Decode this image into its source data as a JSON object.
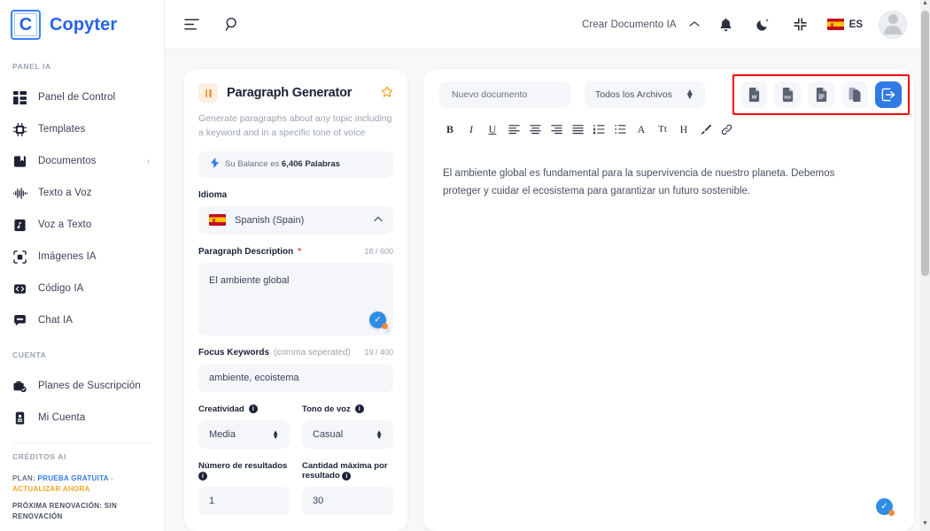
{
  "brand": {
    "mark": "C",
    "name": "Copyter"
  },
  "sidebar": {
    "section_panel": "PANEL IA",
    "items": [
      {
        "label": "Panel de Control",
        "icon": "dashboard-icon"
      },
      {
        "label": "Templates",
        "icon": "chip-icon"
      },
      {
        "label": "Documentos",
        "icon": "documents-icon",
        "caret": "›"
      },
      {
        "label": "Texto a Voz",
        "icon": "waveform-icon"
      },
      {
        "label": "Voz a Texto",
        "icon": "audio-file-icon"
      },
      {
        "label": "Imágenes IA",
        "icon": "image-ai-icon"
      },
      {
        "label": "Código IA",
        "icon": "code-icon"
      },
      {
        "label": "Chat IA",
        "icon": "chat-icon"
      }
    ],
    "section_account": "CUENTA",
    "account_items": [
      {
        "label": "Planes de Suscripción",
        "icon": "subscription-icon"
      },
      {
        "label": "Mi Cuenta",
        "icon": "account-card-icon"
      }
    ],
    "section_credits": "CRÉDITOS AI",
    "plan_prefix": "PLAN:",
    "plan_value": "PRUEBA GRATUITA",
    "plan_sep": "-",
    "plan_upgrade": "ACTUALIZAR AHORA",
    "renewal": "PRÓXIMA RENOVACIÓN: SIN RENOVACIÓN"
  },
  "topbar": {
    "menu_icon": "menu-lines-icon",
    "search_icon": "search-icon",
    "create_doc": "Crear Documento IA",
    "chevron": "⌃",
    "bell_icon": "bell-icon",
    "theme_icon": "moon-icon",
    "fullscreen_icon": "compress-icon",
    "lang_code": "ES",
    "lang_flag": "flag-es-icon",
    "avatar": "user-avatar"
  },
  "generator": {
    "badge_icon": "template-bars-icon",
    "title": "Paragraph Generator",
    "star_icon": "star-outline-icon",
    "description": "Generate paragraphs about any topic including a keyword and in a specific tone of voice",
    "balance_bolt": "⚡",
    "balance_prefix": "Su Balance es ",
    "balance_value": "6,406 Palabras",
    "language_label": "Idioma",
    "language_value": "Spanish (Spain)",
    "desc_label": "Paragraph Description",
    "desc_required": "*",
    "desc_counter": "18 / 600",
    "desc_value": "El ambiente global",
    "keywords_label": "Focus Keywords",
    "keywords_hint": "(comma seperated)",
    "keywords_counter": "19 / 400",
    "keywords_value": "ambiente, ecoistema",
    "creativity_label": "Creatividad",
    "creativity_value": "Media",
    "tone_label": "Tono de voz",
    "tone_value": "Casual",
    "results_label": "Número de resultados",
    "results_value": "1",
    "maxlen_label": "Cantidad máxima por resultado",
    "maxlen_value": "30"
  },
  "editor": {
    "doc_name_value": "Nuevo documento",
    "file_filter_value": "Todos los Archivos",
    "export_buttons": [
      {
        "name": "export-word-button",
        "label": "W"
      },
      {
        "name": "export-pdf-button",
        "label": "PDF"
      },
      {
        "name": "export-text-button",
        "label": "TXT"
      },
      {
        "name": "copy-document-button",
        "label": "COPY"
      },
      {
        "name": "save-document-button",
        "label": "SAVE"
      }
    ],
    "format_buttons": [
      {
        "name": "bold-button",
        "glyph": "B"
      },
      {
        "name": "italic-button",
        "glyph": "I"
      },
      {
        "name": "underline-button",
        "glyph": "U"
      },
      {
        "name": "align-left-button",
        "glyph": "align-left-icon"
      },
      {
        "name": "align-center-button",
        "glyph": "align-center-icon"
      },
      {
        "name": "align-right-button",
        "glyph": "align-right-icon"
      },
      {
        "name": "align-justify-button",
        "glyph": "align-justify-icon"
      },
      {
        "name": "ordered-list-button",
        "glyph": "ordered-list-icon"
      },
      {
        "name": "unordered-list-button",
        "glyph": "unordered-list-icon"
      },
      {
        "name": "font-color-button",
        "glyph": "A"
      },
      {
        "name": "font-size-button",
        "glyph": "Tt"
      },
      {
        "name": "heading-button",
        "glyph": "H"
      },
      {
        "name": "highlight-button",
        "glyph": "brush-icon"
      },
      {
        "name": "link-button",
        "glyph": "link-icon"
      }
    ],
    "content": "El ambiente global es fundamental para la supervivencia de nuestro planeta. Debemos proteger y cuidar el ecosistema para garantizar un futuro sostenible."
  },
  "colors": {
    "brand_blue": "#2563eb",
    "accent_blue": "#2f7ae5",
    "highlight_red": "#ff0000",
    "orange": "#f5a623",
    "canvas": "#f7f8fa"
  }
}
